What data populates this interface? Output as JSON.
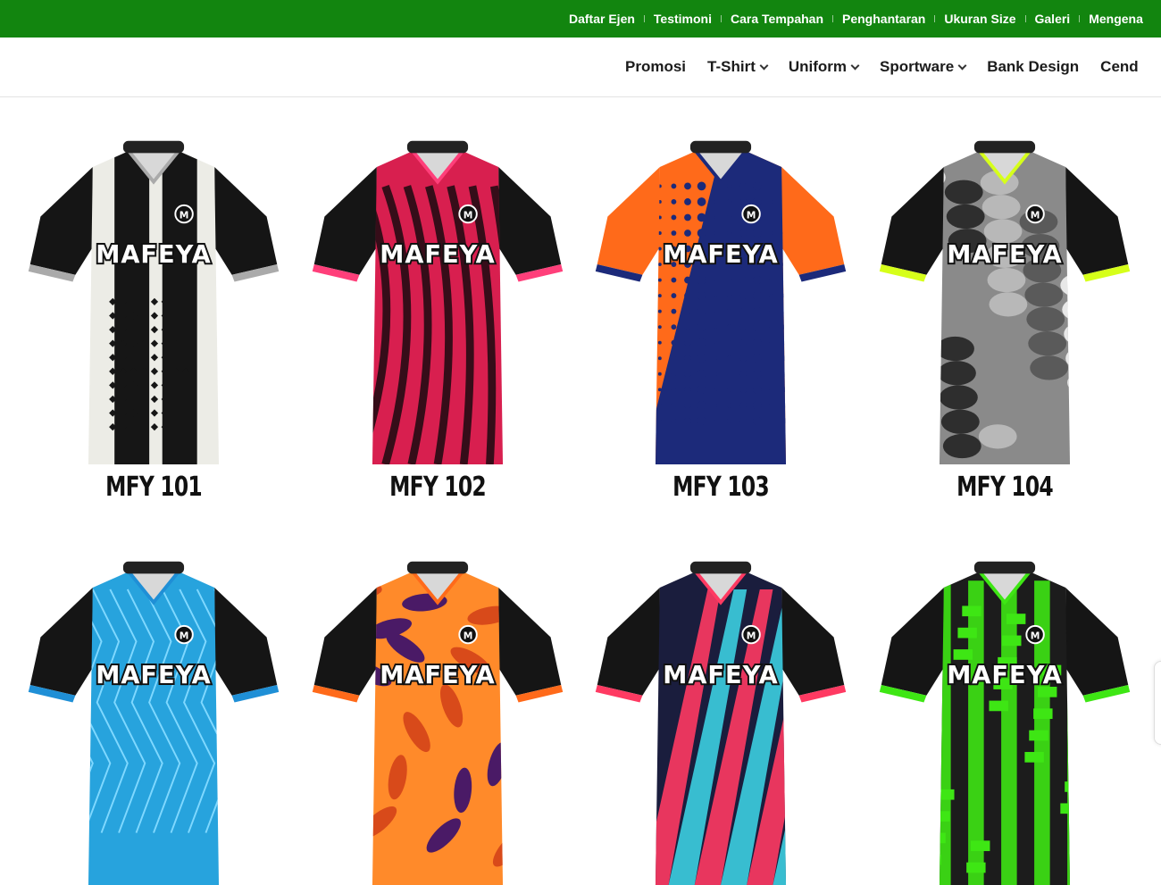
{
  "topbar": {
    "links": [
      "Daftar Ejen",
      "Testimoni",
      "Cara Tempahan",
      "Penghantaran",
      "Ukuran Size",
      "Galeri",
      "Mengena"
    ]
  },
  "nav": {
    "items": [
      {
        "label": "Promosi",
        "dropdown": false
      },
      {
        "label": "T-Shirt",
        "dropdown": true
      },
      {
        "label": "Uniform",
        "dropdown": true
      },
      {
        "label": "Sportware",
        "dropdown": true
      },
      {
        "label": "Bank Design",
        "dropdown": false
      },
      {
        "label": "Cend",
        "dropdown": false
      }
    ]
  },
  "brand_text": "MAFEYA",
  "products": [
    {
      "title": "MFY 101",
      "body": "#ecece6",
      "sleeve": "#151515",
      "accent": "#1b1b1b",
      "cuff": "#aaaaaa",
      "pattern": "stripes"
    },
    {
      "title": "MFY 102",
      "body": "#d81f4f",
      "sleeve": "#151515",
      "accent": "#1a0a0f",
      "cuff": "#ff3f7a",
      "pattern": "brush"
    },
    {
      "title": "MFY 103",
      "body": "#ff6a1a",
      "sleeve": "#ff6a1a",
      "accent": "#1c2a7a",
      "cuff": "#1c2a7a",
      "pattern": "dots"
    },
    {
      "title": "MFY 104",
      "body": "#8a8a8a",
      "sleeve": "#151515",
      "accent": "#2e2e2e",
      "cuff": "#d6ff1a",
      "pattern": "camo"
    },
    {
      "title": "",
      "body": "#27a3dd",
      "sleeve": "#151515",
      "accent": "#7fd8ff",
      "cuff": "#1f8fd6",
      "pattern": "lines"
    },
    {
      "title": "",
      "body": "#ff8a2a",
      "sleeve": "#151515",
      "accent": "#4a1a66",
      "cuff": "#ff6a1a",
      "pattern": "splash"
    },
    {
      "title": "",
      "body": "#1a1d3d",
      "sleeve": "#151515",
      "accent": "#ff3a62",
      "cuff": "#ff3a62",
      "pattern": "slash"
    },
    {
      "title": "",
      "body": "#1c1c1c",
      "sleeve": "#151515",
      "accent": "#3ee614",
      "cuff": "#3ee614",
      "pattern": "grunge"
    }
  ]
}
